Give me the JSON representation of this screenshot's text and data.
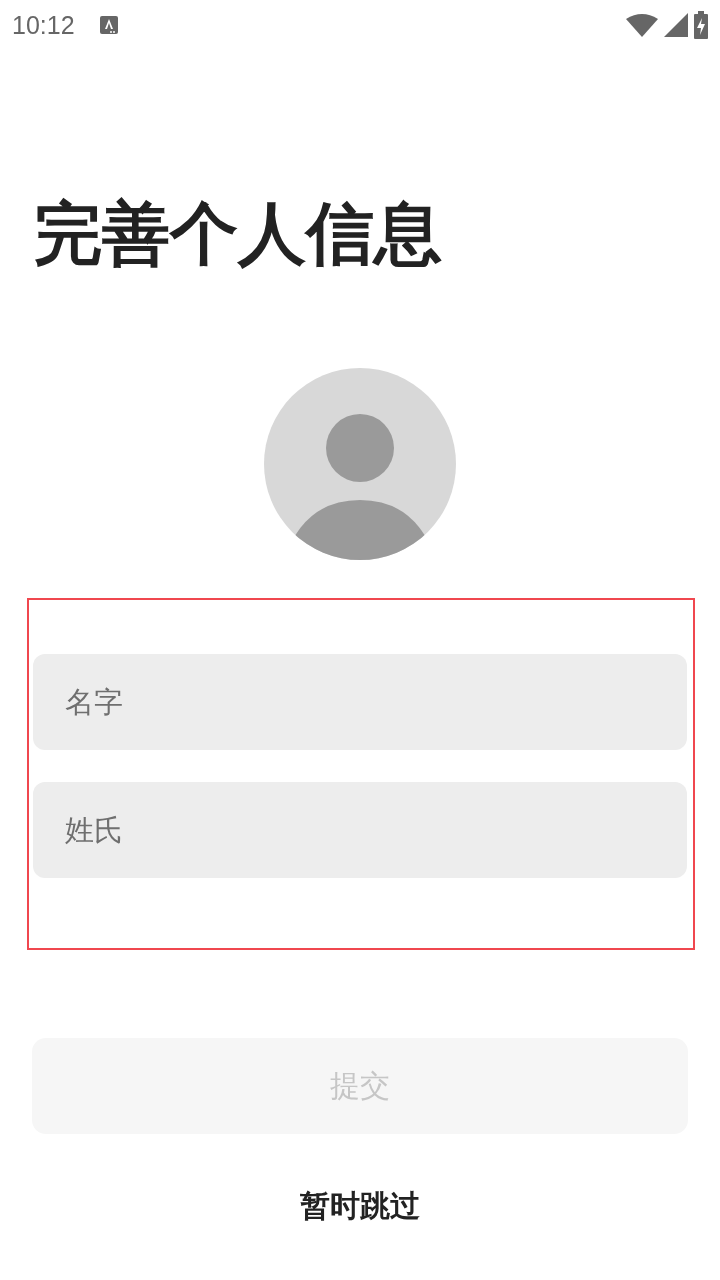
{
  "status_bar": {
    "time": "10:12"
  },
  "title": "完善个人信息",
  "form": {
    "highlighted": true,
    "fields": [
      {
        "placeholder": "名字"
      },
      {
        "placeholder": "姓氏"
      }
    ]
  },
  "submit_button": {
    "label": "提交",
    "disabled": true
  },
  "skip_link": "暂时跳过"
}
